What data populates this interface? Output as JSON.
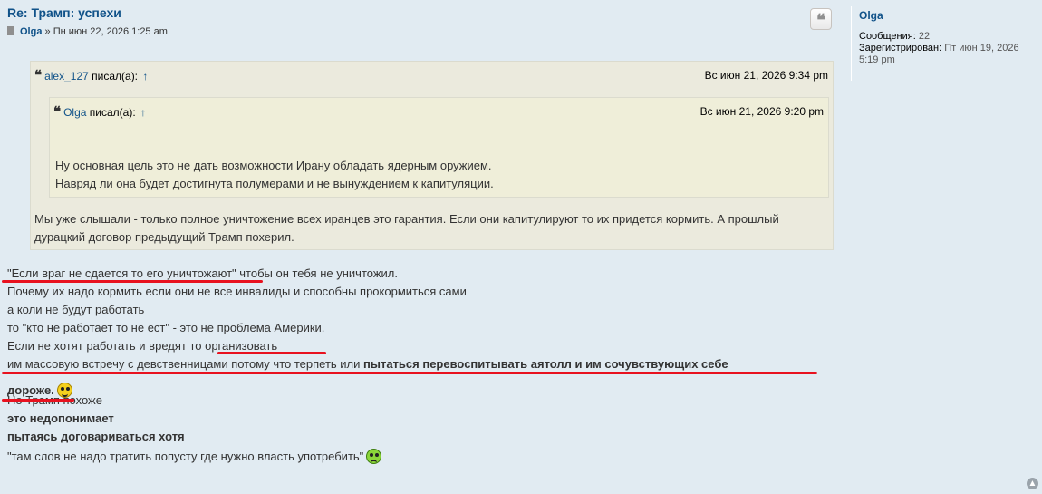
{
  "post": {
    "title": "Re: Трамп: успехи",
    "author": "Olga",
    "separator": "»",
    "datetime": "Пн июн 22, 2026 1:25 am",
    "quote_button_icon": "quote-icon"
  },
  "profile": {
    "username": "Olga",
    "posts_label": "Сообщения:",
    "posts_value": "22",
    "registered_label": "Зарегистрирован:",
    "registered_value": "Пт июн 19, 2026 5:19 pm"
  },
  "quote_outer": {
    "user": "alex_127",
    "wrote": "писал(а):",
    "arrow": "↑",
    "date": "Вс июн 21, 2026 9:34 pm",
    "text_line1": "Мы уже слышали - только полное уничтожение всех иранцев это гарантия. Если они капитулируют то их придется кормить. А прошлый",
    "text_line2": "дурацкий договор предыдущий Трамп похерил."
  },
  "quote_inner": {
    "user": "Olga",
    "wrote": "писал(а):",
    "arrow": "↑",
    "date": "Вс июн 21, 2026 9:20 pm",
    "text_line1": "Ну основная цель это не дать возможности Ирану обладать ядерным оружием.",
    "text_line2": "Навряд ли она будет достигнута полумерами и не вынуждением к капитуляции."
  },
  "body": {
    "l1": "\"Если враг не сдается то его уничтожают\" чтобы он тебя не уничтожил.",
    "l2": "Почему их надо кормить если они не все инвалиды и способны прокормиться сами",
    "l3": "а коли не будут работать",
    "l4": "то \"кто не работает то не ест\" - это не проблема Америки.",
    "l5": "Если не хотят работать и вредят то организовать",
    "l6a": "им массовую встречу с девственницами потому что терпеть или ",
    "l6b": "пытаться перевоспитывать аятолл и им сочувствующих себе",
    "l7": "дороже.",
    "l8": "Но Трамп похоже",
    "l9": "это недопонимает",
    "l10": "пытаясь договариваться хотя",
    "l11": "\"там слов не надо тратить попусту где нужно власть употребить\""
  },
  "colors": {
    "link": "#105289",
    "underline_red": "#e8121f",
    "background": "#e1ebf2",
    "quote_bg": "#ebeadd"
  }
}
